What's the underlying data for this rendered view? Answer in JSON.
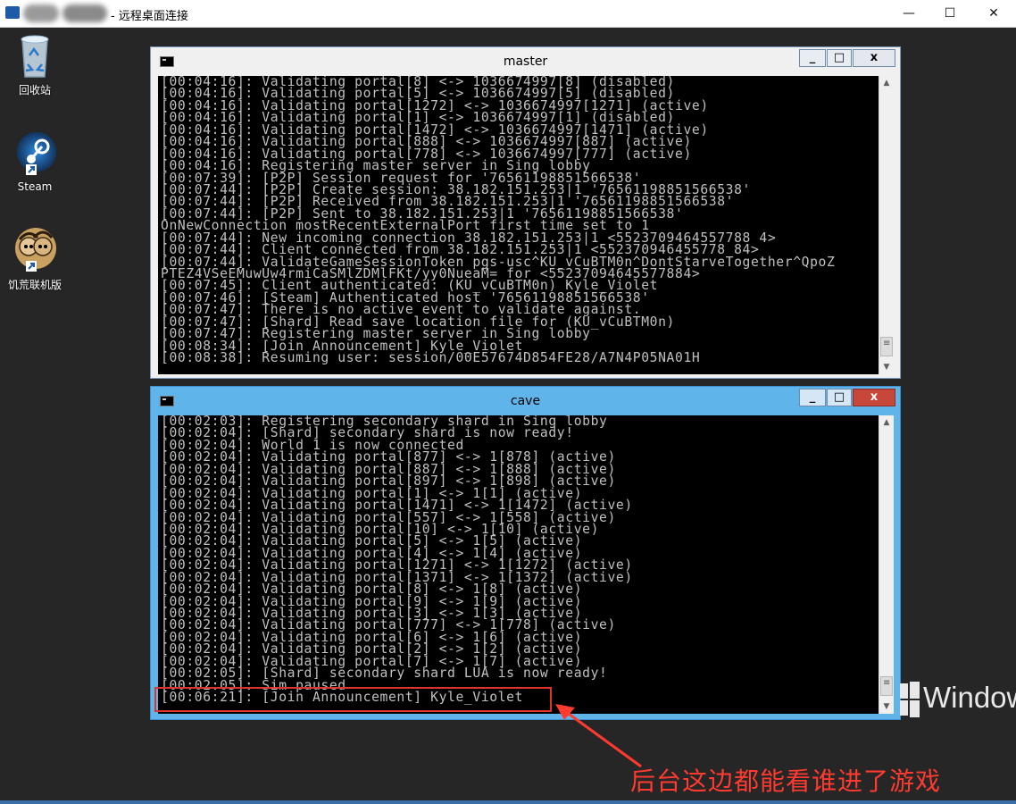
{
  "rdp": {
    "title": "- 远程桌面连接",
    "minimize": "—",
    "maximize": "☐",
    "close": "✕"
  },
  "desktop_icons": [
    {
      "label": "回收站",
      "icon": "recycle-bin-icon"
    },
    {
      "label": "Steam",
      "icon": "steam-icon"
    },
    {
      "label": "饥荒联机版",
      "icon": "dont-starve-together-icon"
    }
  ],
  "windows": {
    "master": {
      "title": "master",
      "minimize": "_",
      "maximize": "□",
      "close": "x",
      "lines": [
        "[00:04:16]: Validating portal[8] <-> 1036674997[8] (disabled)",
        "[00:04:16]: Validating portal[5] <-> 1036674997[5] (disabled)",
        "[00:04:16]: Validating portal[1272] <-> 1036674997[1271] (active)",
        "[00:04:16]: Validating portal[1] <-> 1036674997[1] (disabled)",
        "[00:04:16]: Validating portal[1472] <-> 1036674997[1471] (active)",
        "[00:04:16]: Validating portal[888] <-> 1036674997[887] (active)",
        "[00:04:16]: Validating portal[778] <-> 1036674997[777] (active)",
        "[00:04:16]: Registering master server in Sing lobby",
        "[00:07:39]: [P2P] Session request for '76561198851566538'",
        "[00:07:44]: [P2P] Create session: 38.182.151.253|1 '76561198851566538'",
        "[00:07:44]: [P2P] Received from 38.182.151.253|1 '76561198851566538'",
        "[00:07:44]: [P2P] Sent to 38.182.151.253|1 '76561198851566538'",
        "OnNewConnection mostRecentExternalPort first time set to 1",
        "[00:07:44]: New incoming connection 38.182.151.253|1 <5523709464557788 4>",
        "[00:07:44]: Client connected from 38.182.151.253|1 <552370946455778 84>",
        "[00:07:44]: ValidateGameSessionToken pgs-usc^KU_vCuBTM0n^DontStarveTogether^QpoZ",
        "PTEZ4VSeEMuwUw4rmiCaSMlZDMlFKt/yy0NueaM= for <55237094645577884>",
        "[00:07:45]: Client authenticated: (KU_vCuBTM0n) Kyle_Violet",
        "[00:07:46]: [Steam] Authenticated host '76561198851566538'",
        "[00:07:47]: There is no active event to validate against.",
        "[00:07:47]: [Shard] Read save location file for (KU_vCuBTM0n)",
        "[00:07:47]: Registering master server in Sing lobby",
        "[00:08:34]: [Join Announcement] Kyle_Violet",
        "[00:08:38]: Resuming user: session/00E57674D854FE28/A7N4P05NA01H"
      ]
    },
    "cave": {
      "title": "cave",
      "minimize": "_",
      "maximize": "□",
      "close": "x",
      "lines": [
        "[00:02:03]: Registering secondary shard in Sing lobby",
        "[00:02:04]: [Shard] secondary shard is now ready!",
        "[00:02:04]: World 1 is now connected",
        "[00:02:04]: Validating portal[877] <-> 1[878] (active)",
        "[00:02:04]: Validating portal[887] <-> 1[888] (active)",
        "[00:02:04]: Validating portal[897] <-> 1[898] (active)",
        "[00:02:04]: Validating portal[1] <-> 1[1] (active)",
        "[00:02:04]: Validating portal[1471] <-> 1[1472] (active)",
        "[00:02:04]: Validating portal[557] <-> 1[558] (active)",
        "[00:02:04]: Validating portal[10] <-> 1[10] (active)",
        "[00:02:04]: Validating portal[5] <-> 1[5] (active)",
        "[00:02:04]: Validating portal[4] <-> 1[4] (active)",
        "[00:02:04]: Validating portal[1271] <-> 1[1272] (active)",
        "[00:02:04]: Validating portal[1371] <-> 1[1372] (active)",
        "[00:02:04]: Validating portal[8] <-> 1[8] (active)",
        "[00:02:04]: Validating portal[9] <-> 1[9] (active)",
        "[00:02:04]: Validating portal[3] <-> 1[3] (active)",
        "[00:02:04]: Validating portal[777] <-> 1[778] (active)",
        "[00:02:04]: Validating portal[6] <-> 1[6] (active)",
        "[00:02:04]: Validating portal[2] <-> 1[2] (active)",
        "[00:02:04]: Validating portal[7] <-> 1[7] (active)",
        "[00:02:05]: [Shard] secondary shard LUA is now ready!",
        "[00:02:05]: Sim paused",
        "[00:06:21]: [Join Announcement] Kyle_Violet"
      ]
    }
  },
  "annotation": {
    "text": "后台这边都能看谁进了游戏",
    "color": "#ff3b30"
  },
  "watermark": {
    "text": "Window"
  }
}
